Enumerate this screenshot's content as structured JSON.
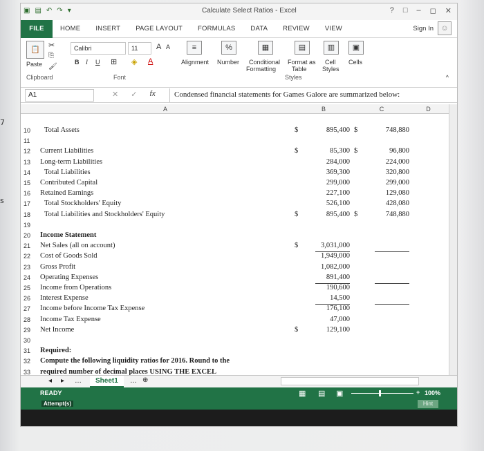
{
  "side_marks": [
    "7",
    "s"
  ],
  "window": {
    "title": "Calculate Select Ratios - Excel",
    "controls": [
      "?",
      "□",
      "–",
      "◻",
      "✕"
    ]
  },
  "tabs": [
    "FILE",
    "HOME",
    "INSERT",
    "PAGE LAYOUT",
    "FORMULAS",
    "DATA",
    "REVIEW",
    "VIEW"
  ],
  "sign_in": "Sign In",
  "ribbon": {
    "paste": "Paste",
    "font_name": "Calibri",
    "font_size": "11",
    "grow": "A",
    "shrink": "A",
    "bold": "B",
    "italic": "I",
    "underline": "U",
    "alignment": "Alignment",
    "number": "Number",
    "percent": "%",
    "conditional": "Conditional",
    "formatting": "Formatting",
    "format_as": "Format as",
    "table": "Table",
    "cell": "Cell",
    "styles_btn": "Styles",
    "cells": "Cells",
    "groups": [
      "Clipboard",
      "Font",
      "Styles"
    ]
  },
  "formula_bar": {
    "name_box": "A1",
    "fx": "fx",
    "content": "Condensed financial statements for Games Galore are summarized below:"
  },
  "columns": [
    "A",
    "B",
    "C",
    "D"
  ],
  "rows": [
    {
      "n": "10",
      "label": "Total Assets",
      "indent": 1,
      "b_dollar": "$",
      "b": "895,400",
      "c_dollar": "$",
      "c": "748,880"
    },
    {
      "n": "11",
      "label": ""
    },
    {
      "n": "12",
      "label": "Current Liabilities",
      "b_dollar": "$",
      "b": "85,300",
      "c_dollar": "$",
      "c": "96,800"
    },
    {
      "n": "13",
      "label": "Long-term Liabilities",
      "b": "284,000",
      "c": "224,000"
    },
    {
      "n": "14",
      "label": "Total Liabilities",
      "indent": 1,
      "b": "369,300",
      "c": "320,800"
    },
    {
      "n": "15",
      "label": "Contributed Capital",
      "b": "299,000",
      "c": "299,000"
    },
    {
      "n": "16",
      "label": "Retained Earnings",
      "b": "227,100",
      "c": "129,080"
    },
    {
      "n": "17",
      "label": "Total Stockholders' Equity",
      "indent": 1,
      "b": "526,100",
      "c": "428,080"
    },
    {
      "n": "18",
      "label": "Total Liabilities and Stockholders' Equity",
      "indent": 1,
      "b_dollar": "$",
      "b": "895,400",
      "c_dollar": "$",
      "c": "748,880"
    },
    {
      "n": "19",
      "label": ""
    },
    {
      "n": "20",
      "label": "Income Statement",
      "bold": true
    },
    {
      "n": "21",
      "label": "Net Sales (all on account)",
      "b_dollar": "$",
      "b": "3,031,000"
    },
    {
      "n": "22",
      "label": "Cost of Goods Sold",
      "b": "1,949,000"
    },
    {
      "n": "23",
      "label": "Gross Profit",
      "b": "1,082,000"
    },
    {
      "n": "24",
      "label": "Operating Expenses",
      "b": "891,400"
    },
    {
      "n": "25",
      "label": "Income from Operations",
      "b": "190,600"
    },
    {
      "n": "26",
      "label": "Interest Expense",
      "b": "14,500"
    },
    {
      "n": "27",
      "label": "Income before Income Tax Expense",
      "b": "176,100"
    },
    {
      "n": "28",
      "label": "Income Tax Expense",
      "b": "47,000"
    },
    {
      "n": "29",
      "label": "Net Income",
      "b_dollar": "$",
      "b": "129,100"
    },
    {
      "n": "30",
      "label": ""
    },
    {
      "n": "31",
      "label": "Required:",
      "bold": true
    },
    {
      "n": "32",
      "label": "Compute the following liquidity ratios for 2016. Round to the",
      "bold": true
    },
    {
      "n": "33",
      "label": "required number of decimal places USING THE EXCEL",
      "bold": true
    }
  ],
  "sheet_tab": "Sheet1",
  "status": {
    "ready": "READY",
    "attempts": "Attempt(s)",
    "zoom": "100%",
    "hint": "Hint"
  },
  "colors": {
    "excel_green": "#217346",
    "dark": "#1c1c1c"
  }
}
